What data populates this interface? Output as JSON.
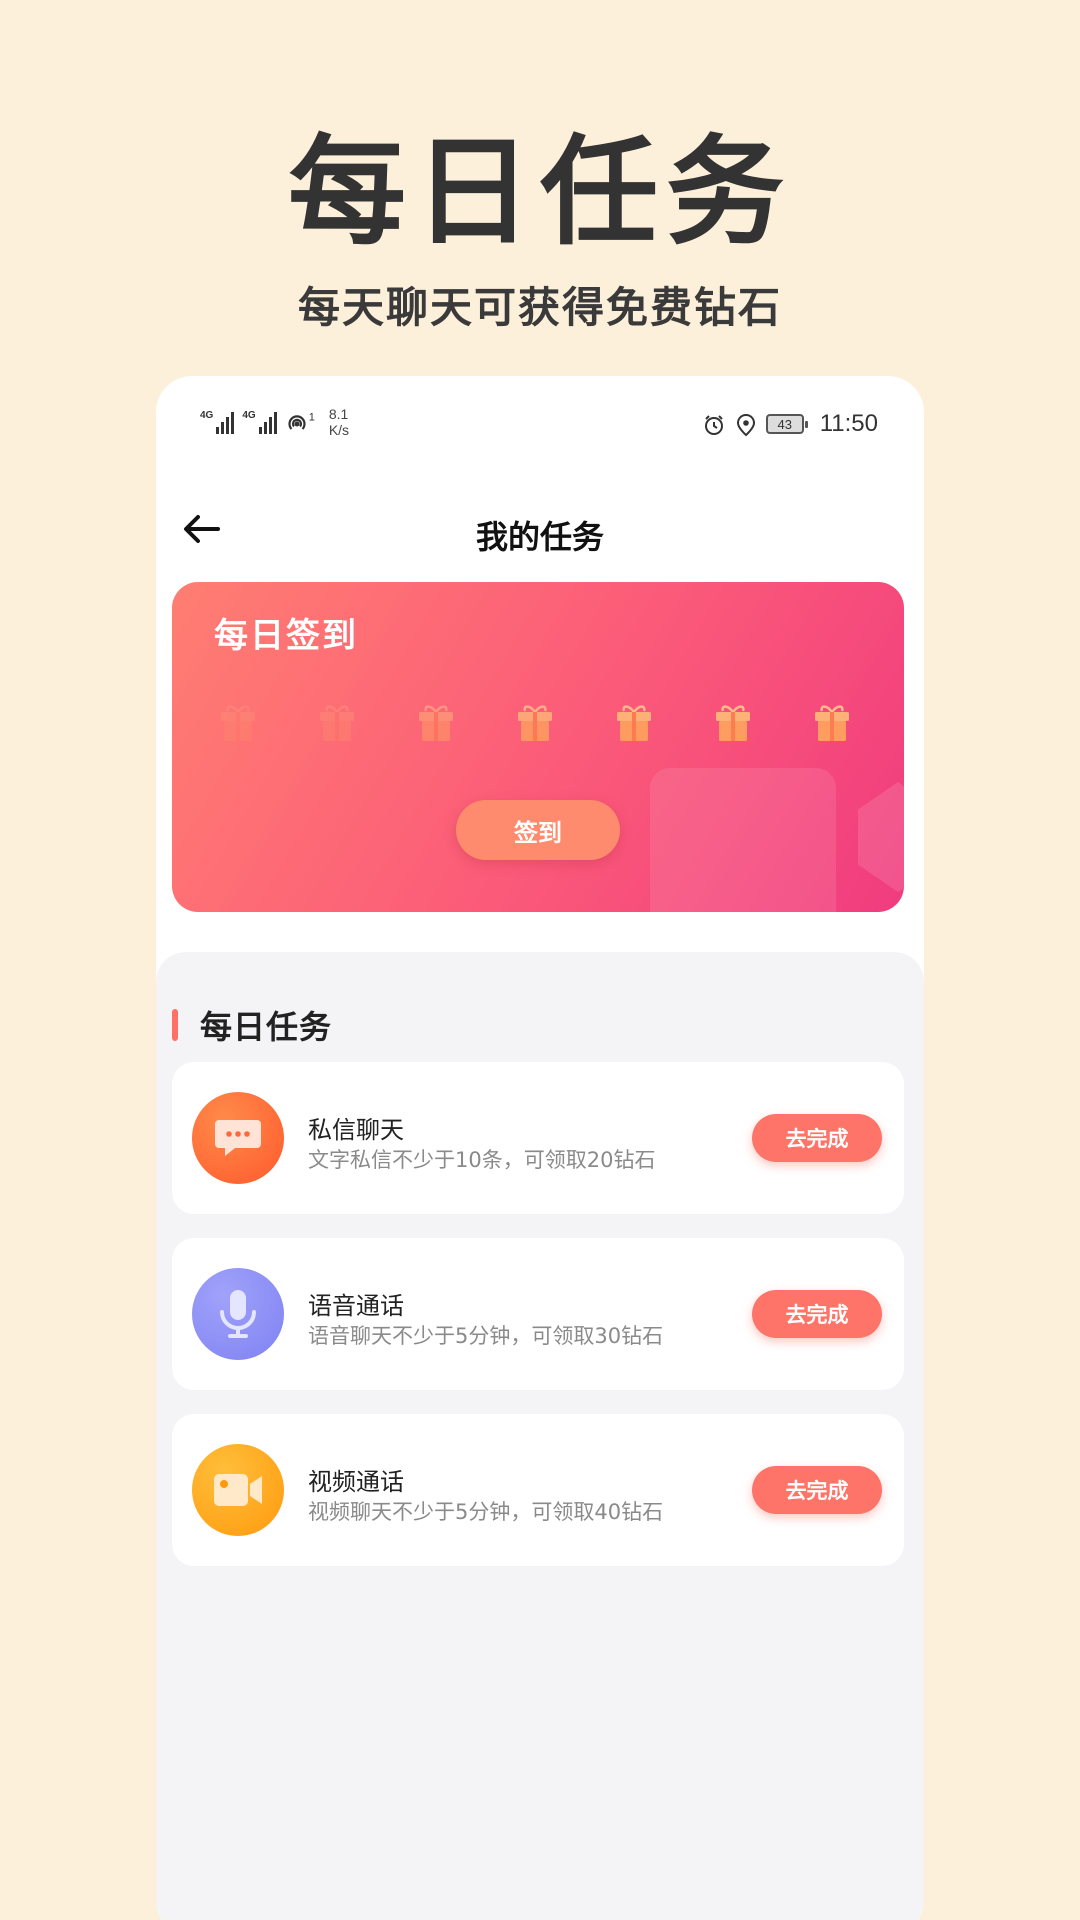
{
  "hero": {
    "title": "每日任务",
    "subtitle": "每天聊天可获得免费钻石"
  },
  "status_bar": {
    "signal_1_label": "4G",
    "signal_2_label": "4G",
    "hotspot_count": "1",
    "net_speed_value": "8.1",
    "net_speed_unit": "K/s",
    "battery_level": "43",
    "time": "11:50",
    "icons": [
      "signal-icon",
      "signal-icon",
      "hotspot-icon",
      "alarm-icon",
      "location-icon",
      "battery-icon"
    ]
  },
  "nav": {
    "title": "我的任务",
    "back_icon": "arrow-left-icon"
  },
  "checkin": {
    "title": "每日签到",
    "days_total": 7,
    "button_label": "签到",
    "gift_icon": "gift-icon"
  },
  "tasks_section": {
    "title": "每日任务",
    "items": [
      {
        "name": "私信聊天",
        "desc": "文字私信不少于10条，可领取20钻石",
        "button": "去完成",
        "icon": "chat-bubble-icon",
        "color": "#FF6A3D"
      },
      {
        "name": "语音通话",
        "desc": "语音聊天不少于5分钟，可领取30钻石",
        "button": "去完成",
        "icon": "microphone-icon",
        "color": "#8A8CF5"
      },
      {
        "name": "视频通话",
        "desc": "视频聊天不少于5分钟，可领取40钻石",
        "button": "去完成",
        "icon": "video-camera-icon",
        "color": "#FFA51A"
      }
    ]
  },
  "colors": {
    "page_background": "#FDF0DB",
    "accent": "#FF7468",
    "checkin_gradient_start": "#FF7E72",
    "checkin_gradient_end": "#F03C7F"
  }
}
